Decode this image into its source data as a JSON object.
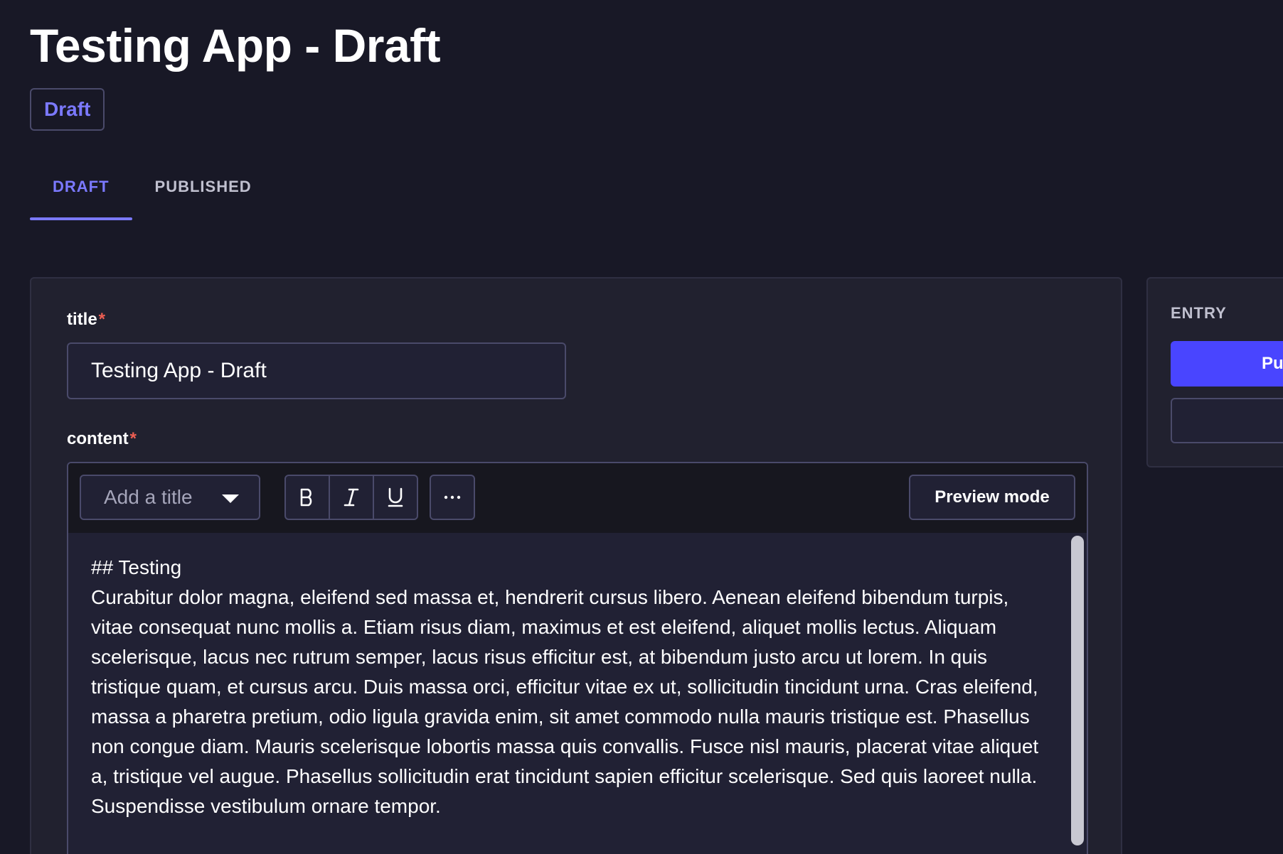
{
  "header": {
    "title": "Testing App - Draft",
    "status_badge": "Draft"
  },
  "tabs": [
    {
      "label": "DRAFT",
      "active": true
    },
    {
      "label": "PUBLISHED",
      "active": false
    }
  ],
  "form": {
    "title_field": {
      "label": "title",
      "required_mark": "*",
      "value": "Testing App - Draft"
    },
    "content_field": {
      "label": "content",
      "required_mark": "*",
      "toolbar": {
        "heading_select_placeholder": "Add a title",
        "bold_icon": "bold-icon",
        "italic_icon": "italic-icon",
        "underline_icon": "underline-icon",
        "more_icon": "more-icon",
        "preview_label": "Preview mode"
      },
      "text": {
        "heading": "## Testing",
        "paragraph1": "Curabitur dolor magna, eleifend sed massa et, hendrerit cursus libero. Aenean eleifend bibendum turpis, vitae consequat nunc mollis a. Etiam risus diam, maximus et est eleifend, aliquet mollis lectus. Aliquam scelerisque, lacus nec rutrum semper, lacus risus efficitur est, at bibendum justo arcu ut lorem. In quis tristique quam, et cursus arcu. Duis massa orci, efficitur vitae ex ut, sollicitudin tincidunt urna. Cras eleifend, massa a pharetra pretium, odio ligula gravida enim, sit amet commodo nulla mauris tristique est. Phasellus non congue diam. Mauris scelerisque lobortis massa quis convallis. Fusce nisl mauris, placerat vitae aliquet a, tristique vel augue. Phasellus sollicitudin erat tincidunt sapien efficitur scelerisque. Sed quis laoreet nulla. Suspendisse vestibulum ornare tempor."
      }
    }
  },
  "sidebar": {
    "section_label": "ENTRY",
    "primary_button": "Pu"
  },
  "colors": {
    "background": "#181826",
    "card": "#21212f",
    "accent": "#7b79ff",
    "primary_button": "#4945ff",
    "required": "#ee5e52"
  }
}
